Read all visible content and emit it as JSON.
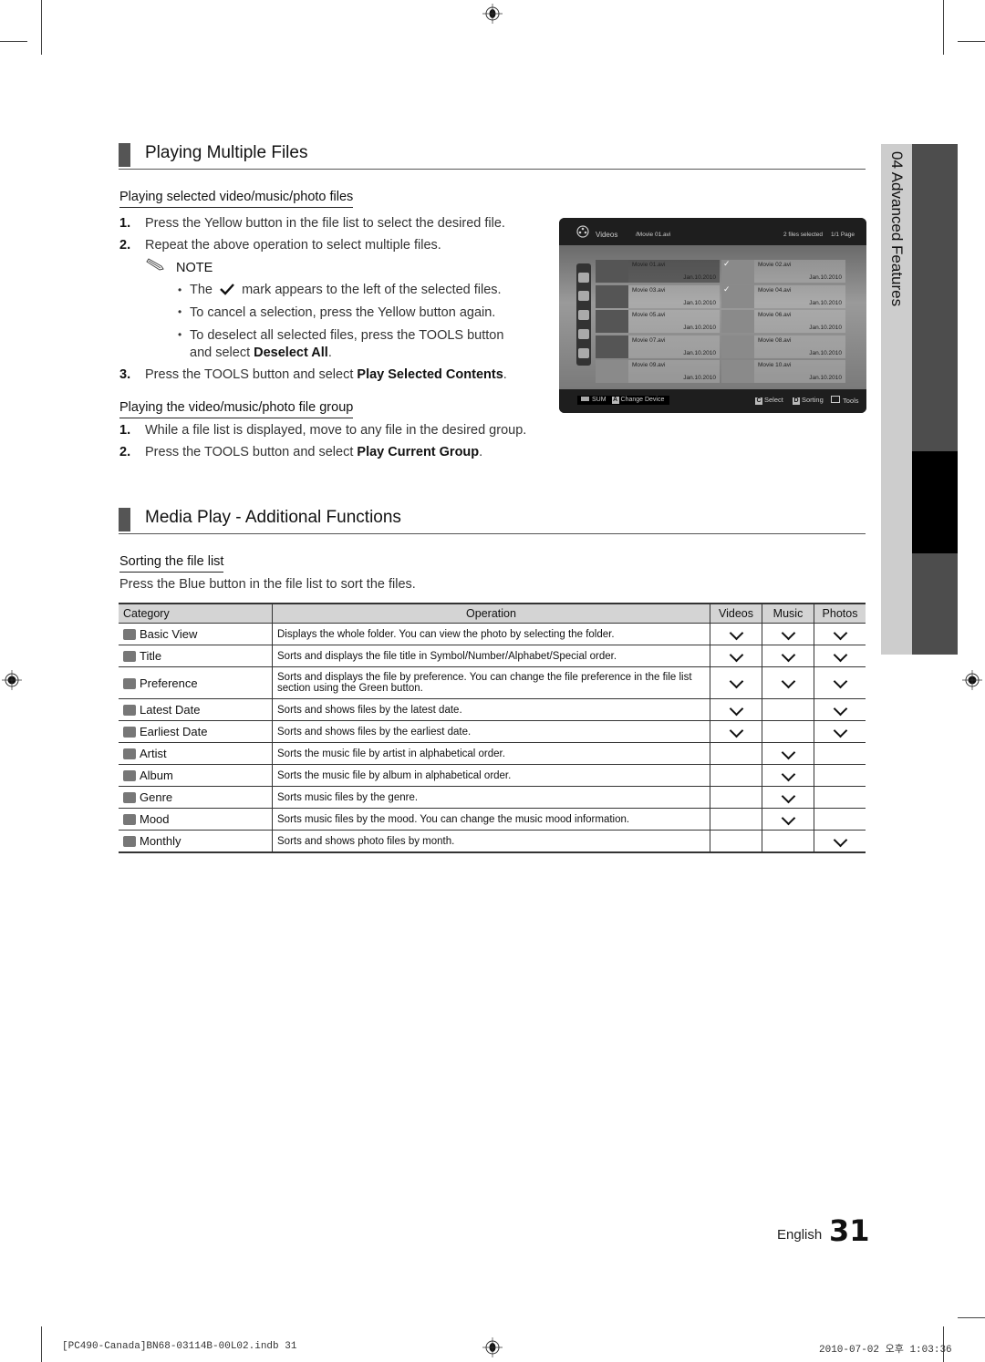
{
  "section1": {
    "title": "Playing Multiple Files",
    "sub1": {
      "title": "Playing selected video/music/photo files",
      "steps": [
        {
          "num": "1.",
          "text": "Press the Yellow button in the file list to select the desired file."
        },
        {
          "num": "2.",
          "text": "Repeat the above operation to select multiple files."
        }
      ],
      "note_label": "NOTE",
      "notes": [
        {
          "pre": "The",
          "post": "mark appears to the left of the selected files."
        },
        {
          "text": "To cancel a selection, press the Yellow button again."
        },
        {
          "text_a": "To deselect all selected files, press the TOOLS button",
          "text_b": "and select ",
          "bold": "Deselect All",
          "end": "."
        }
      ],
      "step3": {
        "num": "3.",
        "text": "Press the TOOLS button and select ",
        "bold": "Play Selected Contents",
        "end": "."
      }
    },
    "sub2": {
      "title": "Playing the video/music/photo file group",
      "steps": [
        {
          "num": "1.",
          "text": "While a file list is displayed, move to any file in the desired group."
        },
        {
          "num": "2.",
          "text": "Press the TOOLS button and select ",
          "bold": "Play Current Group",
          "end": "."
        }
      ]
    }
  },
  "tv_screen": {
    "header": {
      "section": "Videos",
      "path": "/Movie 01.avi",
      "selected_count": "2 files selected",
      "page": "1/1 Page"
    },
    "files": [
      {
        "name": "Movie 01.avi",
        "date": "Jan.10.2010",
        "checked": false,
        "focused": true
      },
      {
        "name": "Movie 02.avi",
        "date": "Jan.10.2010",
        "checked": true
      },
      {
        "name": "Movie 03.avi",
        "date": "Jan.10.2010",
        "checked": false
      },
      {
        "name": "Movie 04.avi",
        "date": "Jan.10.2010",
        "checked": true
      },
      {
        "name": "Movie 05.avi",
        "date": "Jan.10.2010",
        "checked": false
      },
      {
        "name": "Movie 06.avi",
        "date": "Jan.10.2010",
        "checked": false
      },
      {
        "name": "Movie 07.avi",
        "date": "Jan.10.2010",
        "checked": false
      },
      {
        "name": "Movie 08.avi",
        "date": "Jan.10.2010",
        "checked": false
      },
      {
        "name": "Movie 09.avi",
        "date": "Jan.10.2010",
        "checked": false
      },
      {
        "name": "Movie 10.avi",
        "date": "Jan.10.2010",
        "checked": false
      }
    ],
    "footer": {
      "device": "SUM",
      "key_a": "A",
      "change_device": "Change Device",
      "key_c": "C",
      "select": "Select",
      "key_d": "D",
      "sorting": "Sorting",
      "tools": "Tools"
    }
  },
  "section2": {
    "title": "Media Play - Additional Functions",
    "sub1": {
      "title": "Sorting the file list",
      "intro": "Press the Blue button in the file list to sort the files."
    },
    "table": {
      "headers": [
        "Category",
        "Operation",
        "Videos",
        "Music",
        "Photos"
      ],
      "rows": [
        {
          "icon": "folder-icon",
          "category": "Basic View",
          "operation": "Displays the whole folder. You can view the photo by selecting the folder.",
          "videos": true,
          "music": true,
          "photos": true
        },
        {
          "icon": "title-icon",
          "category": "Title",
          "operation": "Sorts and displays the file title in Symbol/Number/Alphabet/Special order.",
          "videos": true,
          "music": true,
          "photos": true
        },
        {
          "icon": "star-icon",
          "category": "Preference",
          "operation": "Sorts and displays the file by preference. You can change the file preference in the file list section using the Green button.",
          "videos": true,
          "music": true,
          "photos": true
        },
        {
          "icon": "calendar-latest-icon",
          "category": "Latest Date",
          "operation": "Sorts and shows files by the latest date.",
          "videos": true,
          "music": false,
          "photos": true
        },
        {
          "icon": "calendar-earliest-icon",
          "category": "Earliest Date",
          "operation": "Sorts and shows files by the earliest date.",
          "videos": true,
          "music": false,
          "photos": true
        },
        {
          "icon": "artist-icon",
          "category": "Artist",
          "operation": "Sorts the music file by artist in alphabetical order.",
          "videos": false,
          "music": true,
          "photos": false
        },
        {
          "icon": "album-icon",
          "category": "Album",
          "operation": "Sorts the music file by album in alphabetical order.",
          "videos": false,
          "music": true,
          "photos": false
        },
        {
          "icon": "genre-icon",
          "category": "Genre",
          "operation": "Sorts music files by the genre.",
          "videos": false,
          "music": true,
          "photos": false
        },
        {
          "icon": "mood-icon",
          "category": "Mood",
          "operation": "Sorts music files by the mood. You can change the music mood information.",
          "videos": false,
          "music": true,
          "photos": false
        },
        {
          "icon": "calendar-monthly-icon",
          "category": "Monthly",
          "operation": "Sorts and shows photo files by month.",
          "videos": false,
          "music": false,
          "photos": true
        }
      ]
    }
  },
  "side_tab": {
    "label": "04  Advanced Features"
  },
  "footer": {
    "language": "English",
    "page_number": "31"
  },
  "slug": {
    "left": "[PC490-Canada]BN68-03114B-00L02.indb   31",
    "right": "2010-07-02  오후 1:03:36"
  }
}
